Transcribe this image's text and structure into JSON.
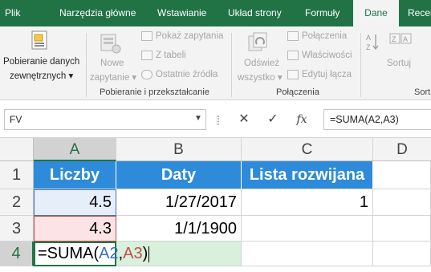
{
  "ribbon_tabs": [
    "Plik",
    "Narzędzia główne",
    "Wstawianie",
    "Układ strony",
    "Formuły",
    "Dane",
    "Recen"
  ],
  "active_tab": "Dane",
  "ribbon": {
    "get_data": {
      "line1": "Pobieranie danych",
      "line2": "zewnętrznych ▾"
    },
    "new_query": {
      "line1": "Nowe",
      "line2": "zapytanie ▾"
    },
    "show_queries": "Pokaż zapytania",
    "from_table": "Z tabeli",
    "recent_sources": "Ostatnie źródła",
    "group_get_transform": "Pobieranie i przekształcanie",
    "refresh_all": {
      "line1": "Odśwież",
      "line2": "wszystko ▾"
    },
    "connections": "Połączenia",
    "properties": "Właściwości",
    "edit_links": "Edytuj łącza",
    "group_connections": "Połączenia",
    "sort": "Sortuj",
    "group_sort_partial": "Sort"
  },
  "formula_bar": {
    "name_box": "FV",
    "cancel": "✕",
    "enter": "✓",
    "fx": "fx",
    "formula": "=SUMA(A2,A3)"
  },
  "columns": [
    "A",
    "B",
    "C",
    "D"
  ],
  "rows": [
    "1",
    "2",
    "3",
    "4"
  ],
  "cells": {
    "A1": "Liczby",
    "B1": "Daty",
    "C1": "Lista rozwijana",
    "A2": "4.5",
    "B2": "1/27/2017",
    "C2": "1",
    "A3": "4.3",
    "B3": "1/1/1900",
    "A4": {
      "prefix": "=SUMA(",
      "ref1": "A2",
      "comma": ",",
      "ref2": "A3",
      "suffix": ")"
    }
  },
  "colors": {
    "accent": "#217346",
    "header_fill": "#2e8bd9",
    "ref1": "#3a6fc2",
    "ref2": "#c0504d"
  }
}
